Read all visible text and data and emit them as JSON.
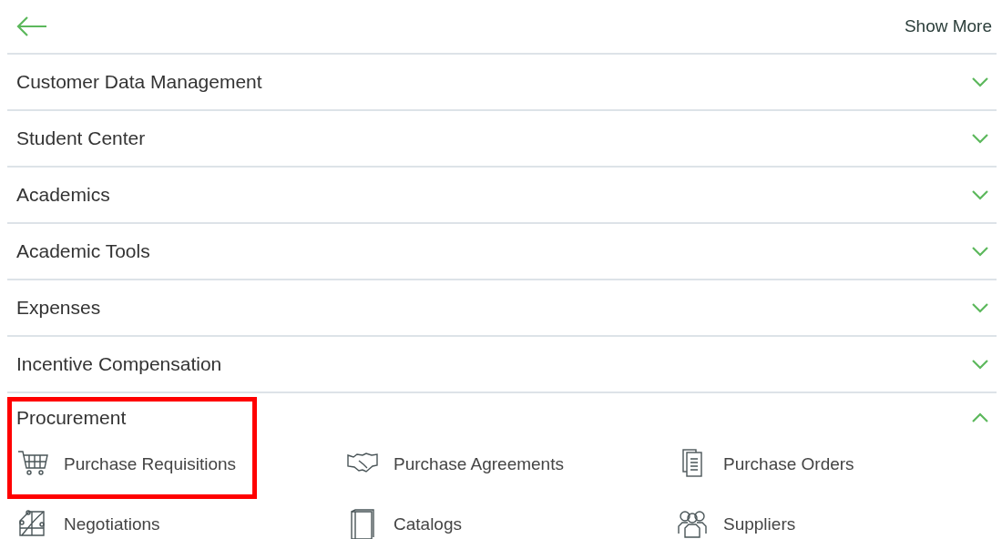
{
  "header": {
    "back": true,
    "show_more": "Show More"
  },
  "sections": [
    {
      "title": "Customer Data Management",
      "expanded": false
    },
    {
      "title": "Student Center",
      "expanded": false
    },
    {
      "title": "Academics",
      "expanded": false
    },
    {
      "title": "Academic Tools",
      "expanded": false
    },
    {
      "title": "Expenses",
      "expanded": false
    },
    {
      "title": "Incentive Compensation",
      "expanded": false
    },
    {
      "title": "Procurement",
      "expanded": true,
      "highlighted": true,
      "tiles": [
        {
          "label": "Purchase Requisitions"
        },
        {
          "label": "Purchase Agreements"
        },
        {
          "label": "Purchase Orders"
        },
        {
          "label": "Negotiations"
        },
        {
          "label": "Catalogs"
        },
        {
          "label": "Suppliers"
        }
      ]
    }
  ]
}
